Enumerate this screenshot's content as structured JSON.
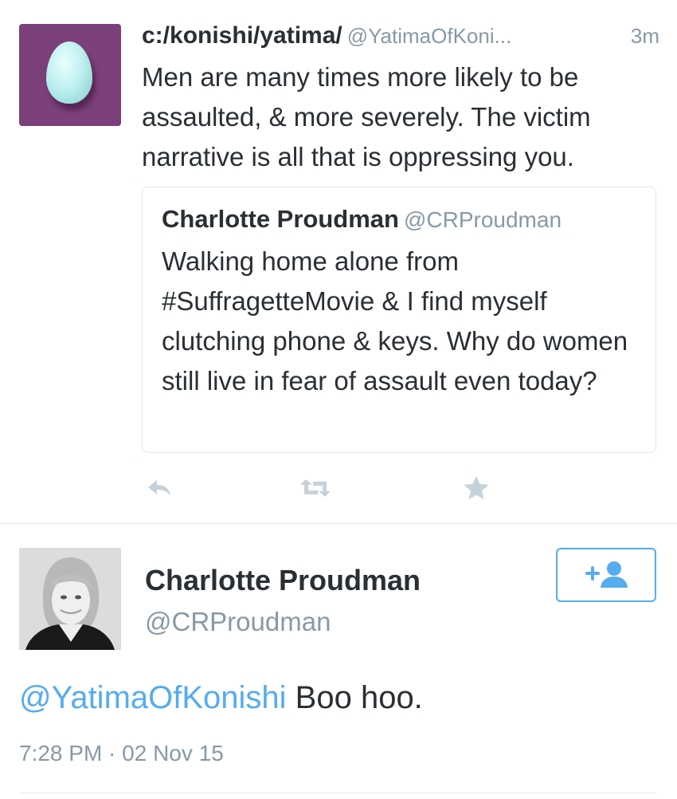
{
  "tweet": {
    "author_name": "c:/konishi/yatima/",
    "author_handle": "@YatimaOfKoni...",
    "time": "3m",
    "text": "Men are many times more likely to be assaulted, & more severely. The victim narrative is all that is oppressing you.",
    "avatar_icon": "egg-avatar",
    "quote": {
      "author_name": "Charlotte Proudman",
      "author_handle": "@CRProudman",
      "text": "Walking home alone from #SuffragetteMovie & I find myself clutching phone & keys. Why do women still live in fear of assault even today?"
    },
    "actions": [
      {
        "icon": "reply-icon"
      },
      {
        "icon": "retweet-icon"
      },
      {
        "icon": "favorite-icon"
      }
    ]
  },
  "reply": {
    "author_name": "Charlotte Proudman",
    "author_handle": "@CRProudman",
    "follow_icon": "follow-user-icon",
    "mention": "@YatimaOfKonishi",
    "text": " Boo hoo.",
    "timestamp": "7:28 PM · 02 Nov 15"
  },
  "colors": {
    "accent": "#55acee",
    "muted": "#8899a6",
    "text": "#292f33",
    "divider": "#e1e8ed"
  }
}
